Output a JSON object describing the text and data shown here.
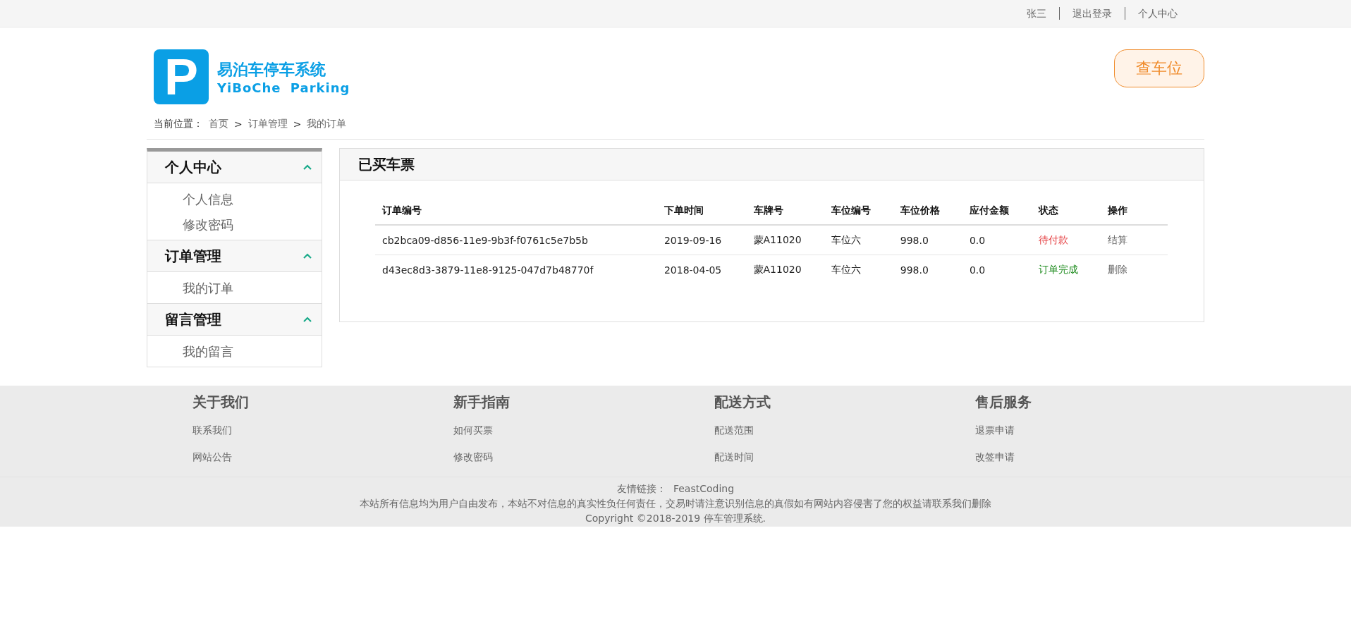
{
  "top_bar": {
    "links": [
      "张三",
      "退出登录",
      "个人中心"
    ]
  },
  "logo": {
    "mark": "P",
    "title": "易泊车停车系统",
    "subtitle": "YiBoChe Parking"
  },
  "search_button": "查车位",
  "breadcrumb": {
    "label": "当前位置：",
    "items": [
      "首页",
      "订单管理",
      "我的订单"
    ],
    "separator": ">"
  },
  "sidebar": {
    "sections": [
      {
        "title": "个人中心",
        "expanded": true,
        "items": [
          "个人信息",
          "修改密码"
        ]
      },
      {
        "title": "订单管理",
        "expanded": true,
        "items": [
          "我的订单"
        ]
      },
      {
        "title": "留言管理",
        "expanded": true,
        "items": [
          "我的留言"
        ]
      }
    ]
  },
  "panel": {
    "title": "已买车票",
    "table": {
      "columns": [
        "订单编号",
        "下单时间",
        "车牌号",
        "车位编号",
        "车位价格",
        "应付金额",
        "状态",
        "操作"
      ],
      "rows": [
        {
          "cells": [
            "cb2bca09-d856-11e9-9b3f-f0761c5e7b5b",
            "2019-09-16",
            "蒙A11020",
            "车位六",
            "998.0",
            "0.0"
          ],
          "status": {
            "text": "待付款",
            "color": "#e4393c"
          },
          "action": "结算"
        },
        {
          "cells": [
            "d43ec8d3-3879-11e8-9125-047d7b48770f",
            "2018-04-05",
            "蒙A11020",
            "车位六",
            "998.0",
            "0.0"
          ],
          "status": {
            "text": "订单完成",
            "color": "#218d21"
          },
          "action": "删除"
        }
      ]
    }
  },
  "footer": {
    "columns": [
      {
        "title": "关于我们",
        "links": [
          "联系我们",
          "网站公告"
        ]
      },
      {
        "title": "新手指南",
        "links": [
          "如何买票",
          "修改密码"
        ]
      },
      {
        "title": "配送方式",
        "links": [
          "配送范围",
          "配送时间"
        ]
      },
      {
        "title": "售后服务",
        "links": [
          "退票申请",
          "改签申请"
        ]
      }
    ],
    "friend_links": {
      "label": "友情链接：",
      "items": [
        "FeastCoding"
      ]
    },
    "disclaimer": "本站所有信息均为用户自由发布，本站不对信息的真实性负任何责任，交易时请注意识别信息的真假如有网站内容侵害了您的权益请联系我们删除",
    "copyright": "Copyright ©2018-2019 停车管理系统."
  }
}
